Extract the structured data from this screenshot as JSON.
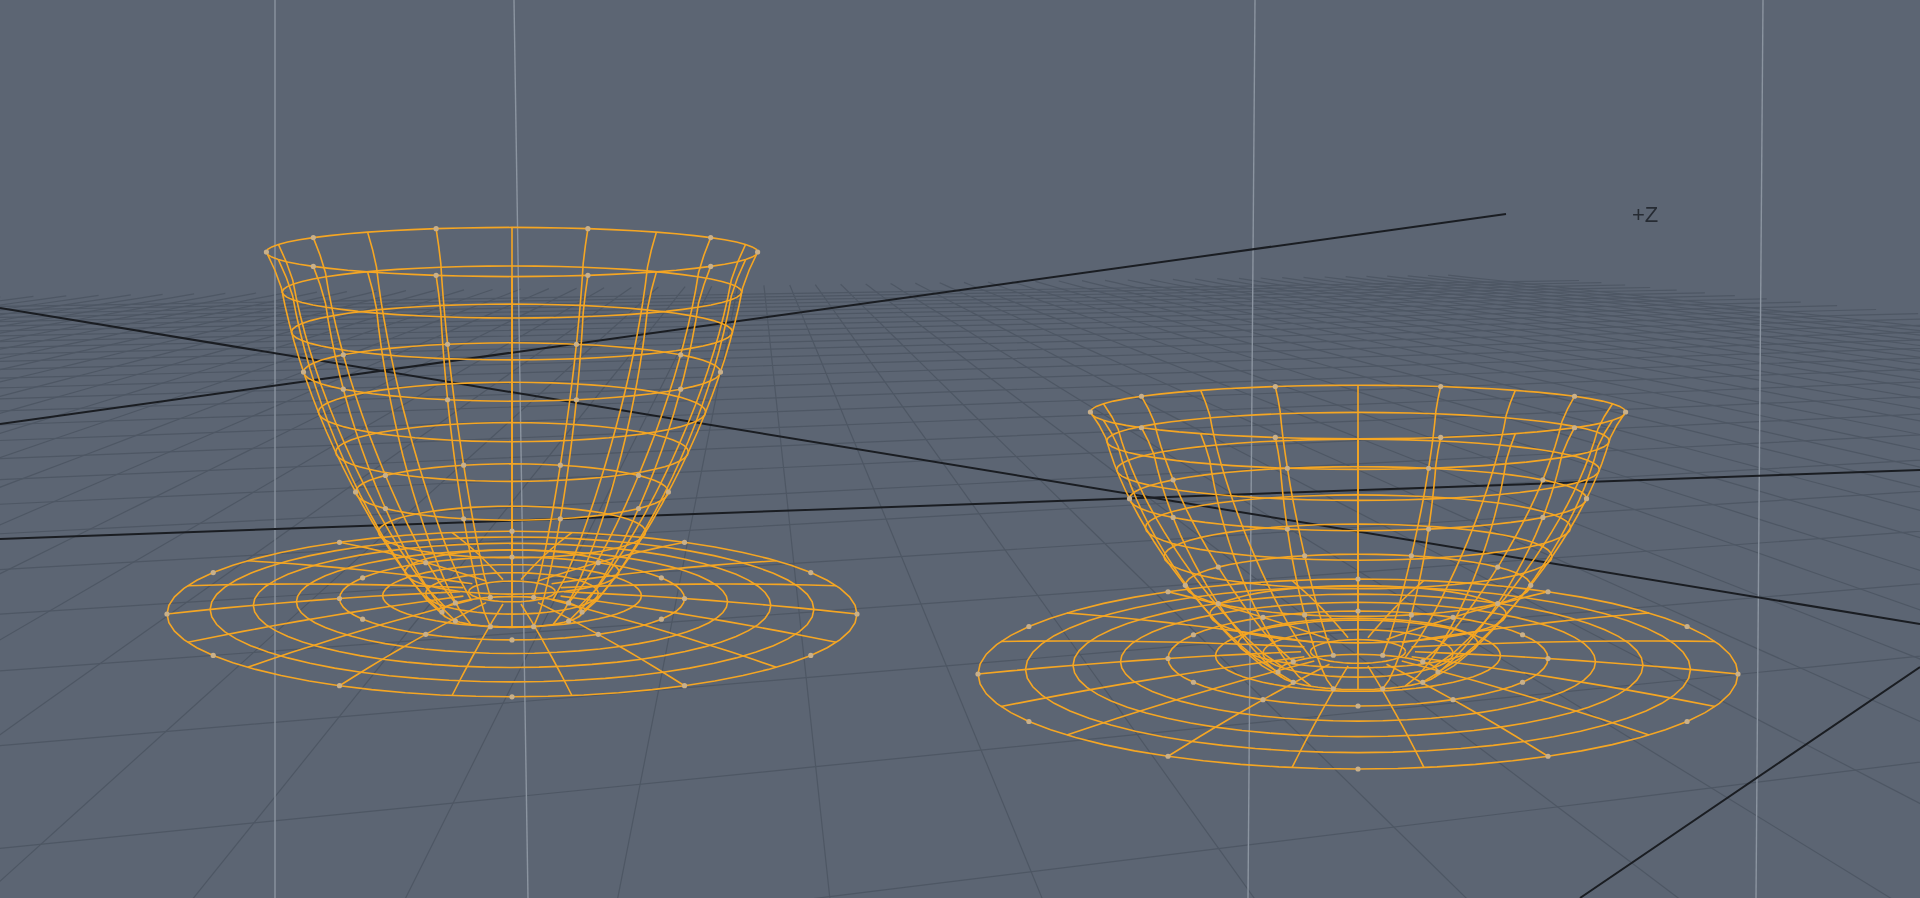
{
  "viewport": {
    "axis_label": "+Z"
  }
}
